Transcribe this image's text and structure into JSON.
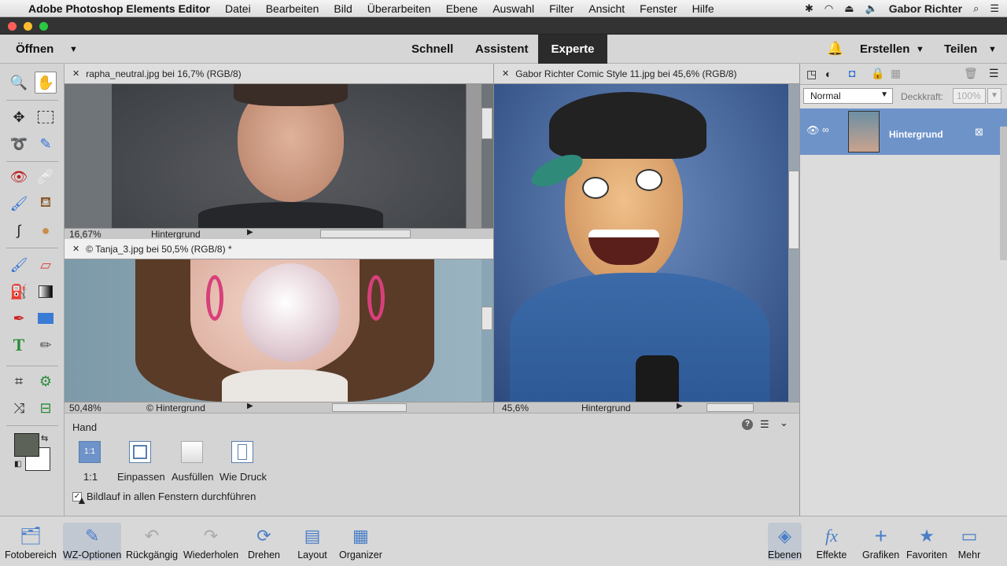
{
  "menubar": {
    "app": "Adobe Photoshop Elements Editor",
    "items": [
      "Datei",
      "Bearbeiten",
      "Bild",
      "Überarbeiten",
      "Ebene",
      "Auswahl",
      "Filter",
      "Ansicht",
      "Fenster",
      "Hilfe"
    ],
    "user": "Gabor Richter"
  },
  "topbar": {
    "open": "Öffnen",
    "modes": {
      "quick": "Schnell",
      "guided": "Assistent",
      "expert": "Experte"
    },
    "create": "Erstellen",
    "share": "Teilen"
  },
  "docs": {
    "doc1": {
      "title": "rapha_neutral.jpg bei 16,7% (RGB/8)",
      "zoom": "16,67%",
      "layer": "Hintergrund"
    },
    "doc2": {
      "title": "© Tanja_3.jpg bei 50,5% (RGB/8) *",
      "zoom": "50,48%",
      "layer": "© Hintergrund"
    },
    "doc3": {
      "title": "Gabor Richter Comic Style 11.jpg bei 45,6% (RGB/8)",
      "zoom": "45,6%",
      "layer": "Hintergrund"
    }
  },
  "layers_panel": {
    "blend_mode": "Normal",
    "opacity_label": "Deckkraft:",
    "opacity_value": "100%",
    "layer_name": "Hintergrund"
  },
  "tool_options": {
    "tool_name": "Hand",
    "buttons": [
      "1:1",
      "Einpassen",
      "Ausfüllen",
      "Wie Druck"
    ],
    "icon_1to1": "1:1",
    "checkbox_label": "Bildlauf in allen Fenstern durchführen",
    "checkbox_checked": true
  },
  "bottombar": {
    "left": [
      "Fotobereich",
      "WZ-Optionen",
      "Rückgängig",
      "Wiederholen",
      "Drehen",
      "Layout",
      "Organizer"
    ],
    "right": [
      "Ebenen",
      "Effekte",
      "Grafiken",
      "Favoriten",
      "Mehr"
    ]
  },
  "colors": {
    "foreground": "#5c6258",
    "background": "#ffffff",
    "active_layer": "#6e93c9",
    "mode_bar_active": "#2b2b2b"
  }
}
